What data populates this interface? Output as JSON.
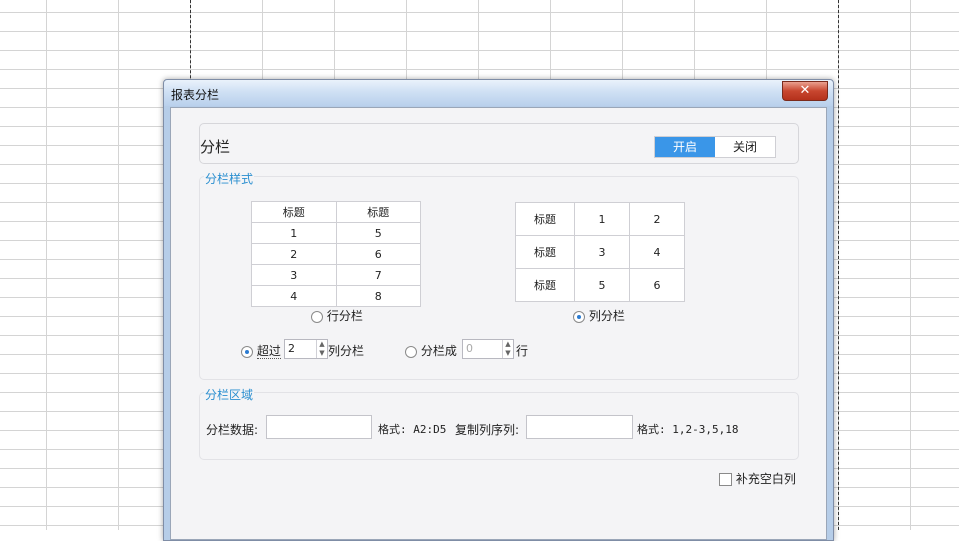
{
  "dialog": {
    "title": "报表分栏",
    "close_glyph": "✕"
  },
  "split": {
    "label": "分栏",
    "toggle_on": "开启",
    "toggle_off": "关闭",
    "toggle_selected": "开启"
  },
  "style_group": {
    "label": "分栏样式",
    "row_sample": {
      "headers": [
        "标题",
        "标题"
      ],
      "rows": [
        [
          "1",
          "5"
        ],
        [
          "2",
          "6"
        ],
        [
          "3",
          "7"
        ],
        [
          "4",
          "8"
        ]
      ]
    },
    "col_sample": {
      "rows": [
        [
          "标题",
          "1",
          "2"
        ],
        [
          "标题",
          "3",
          "4"
        ],
        [
          "标题",
          "5",
          "6"
        ]
      ]
    },
    "row_split_label": "行分栏",
    "col_split_label": "列分栏",
    "selected_mode": "列分栏",
    "exceed_label": "超过",
    "exceed_value": "2",
    "exceed_suffix": "列分栏",
    "split_into_label": "分栏成",
    "split_into_value": "0",
    "split_into_suffix": "行",
    "selected_option": "超过"
  },
  "region_group": {
    "label": "分栏区域",
    "data_label": "分栏数据:",
    "data_value": "",
    "data_format": "格式: A2:D5",
    "copy_label": "复制列序列:",
    "copy_value": "",
    "copy_format": "格式: 1,2-3,5,18"
  },
  "fill_blank": {
    "label": "补充空白列",
    "checked": false
  }
}
